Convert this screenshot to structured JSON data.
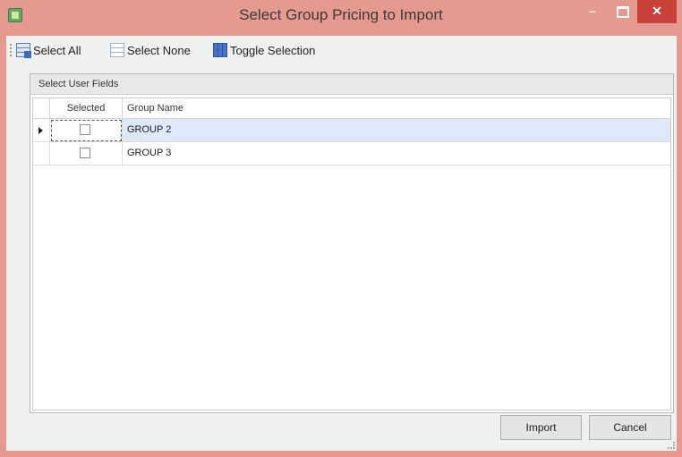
{
  "window": {
    "title": "Select Group Pricing to Import",
    "minimize_label": "–",
    "close_label": "✕"
  },
  "toolbar": {
    "select_all_label": "Select All",
    "select_none_label": "Select None",
    "toggle_selection_label": "Toggle Selection"
  },
  "group": {
    "title": "Select User Fields"
  },
  "grid": {
    "columns": [
      "Selected",
      "Group Name"
    ],
    "rows": [
      {
        "selected": false,
        "group_name": "GROUP 2",
        "active": true
      },
      {
        "selected": false,
        "group_name": "GROUP 3",
        "active": false
      }
    ]
  },
  "buttons": {
    "import_label": "Import",
    "cancel_label": "Cancel"
  },
  "colors": {
    "titlebar": "#e6998e",
    "close_button": "#c9423a",
    "active_row": "#dde8f8"
  },
  "icons": {
    "app": "app-grid-icon",
    "select_all": "grid-select-all-icon",
    "select_none": "grid-select-none-icon",
    "toggle": "grid-toggle-icon"
  }
}
